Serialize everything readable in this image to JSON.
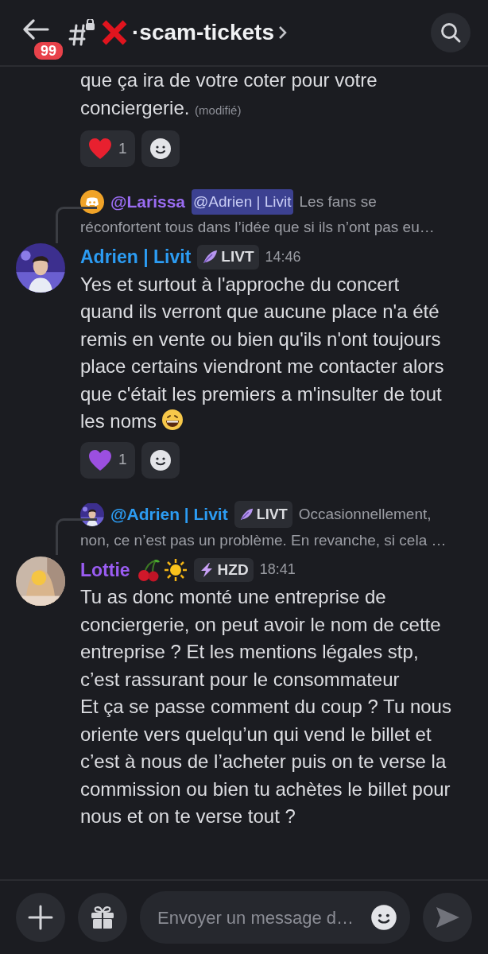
{
  "header": {
    "unread_badge": "99",
    "channel_name": "·scam-tickets"
  },
  "messages": [
    {
      "kind": "continuation",
      "text": "que ça ira de votre coter pour votre conciergerie.",
      "edited": "(modifié)",
      "reactions": [
        {
          "kind": "red-heart",
          "count": "1"
        }
      ]
    },
    {
      "kind": "reply",
      "reply": {
        "avatar": {
          "kind": "discord"
        },
        "author": {
          "name": "@Larissa",
          "color": "#9a6cf2"
        },
        "mention": "@Adrien | Livit",
        "text_lines": [
          "Les fans se",
          "réconfortent tous dans l’idée que si ils n’ont pas eu…"
        ]
      },
      "avatar": {
        "kind": "photo-a"
      },
      "author": {
        "name": "Adrien | Livit",
        "color": "#2c9cf3"
      },
      "tag": {
        "kind": "feather",
        "label": "LIVT"
      },
      "time": "14:46",
      "text": "Yes et surtout à l'approche du concert quand ils verront que aucune place n'a été remis en vente ou bien qu'ils n'ont toujours place certains viendront me contacter alors que c'était les premiers a m'insulter de tout les noms",
      "trailing_emoji": {
        "kind": "grin"
      },
      "reactions": [
        {
          "kind": "purple-heart",
          "count": "1"
        }
      ]
    },
    {
      "kind": "reply",
      "reply": {
        "avatar": {
          "kind": "photo-a"
        },
        "author": {
          "name": "@Adrien | Livit",
          "color": "#2c9cf3"
        },
        "tag": {
          "kind": "feather",
          "label": "LIVT"
        },
        "text_lines": [
          "Occasionnellement,",
          "non, ce n’est pas un problème. En revanche, si cela …"
        ]
      },
      "avatar": {
        "kind": "photo-b"
      },
      "author": {
        "name": "Lottie",
        "color": "#9a5cf2"
      },
      "name_emojis": [
        {
          "kind": "cherries"
        },
        {
          "kind": "sun"
        }
      ],
      "tag": {
        "kind": "bolt",
        "label": "HZD"
      },
      "time": "18:41",
      "text": "Tu as donc monté une entreprise de conciergerie, on peut avoir le nom de cette entreprise ? Et les mentions légales stp, c’est rassurant pour le consommateur\nEt ça se passe comment du coup ? Tu nous oriente vers quelqu’un qui vend le billet et c’est à nous de l’acheter puis on te verse la commission ou bien tu achètes le billet pour nous et on te verse tout ?"
    }
  ],
  "composer": {
    "placeholder": "Envoyer un message d…"
  }
}
